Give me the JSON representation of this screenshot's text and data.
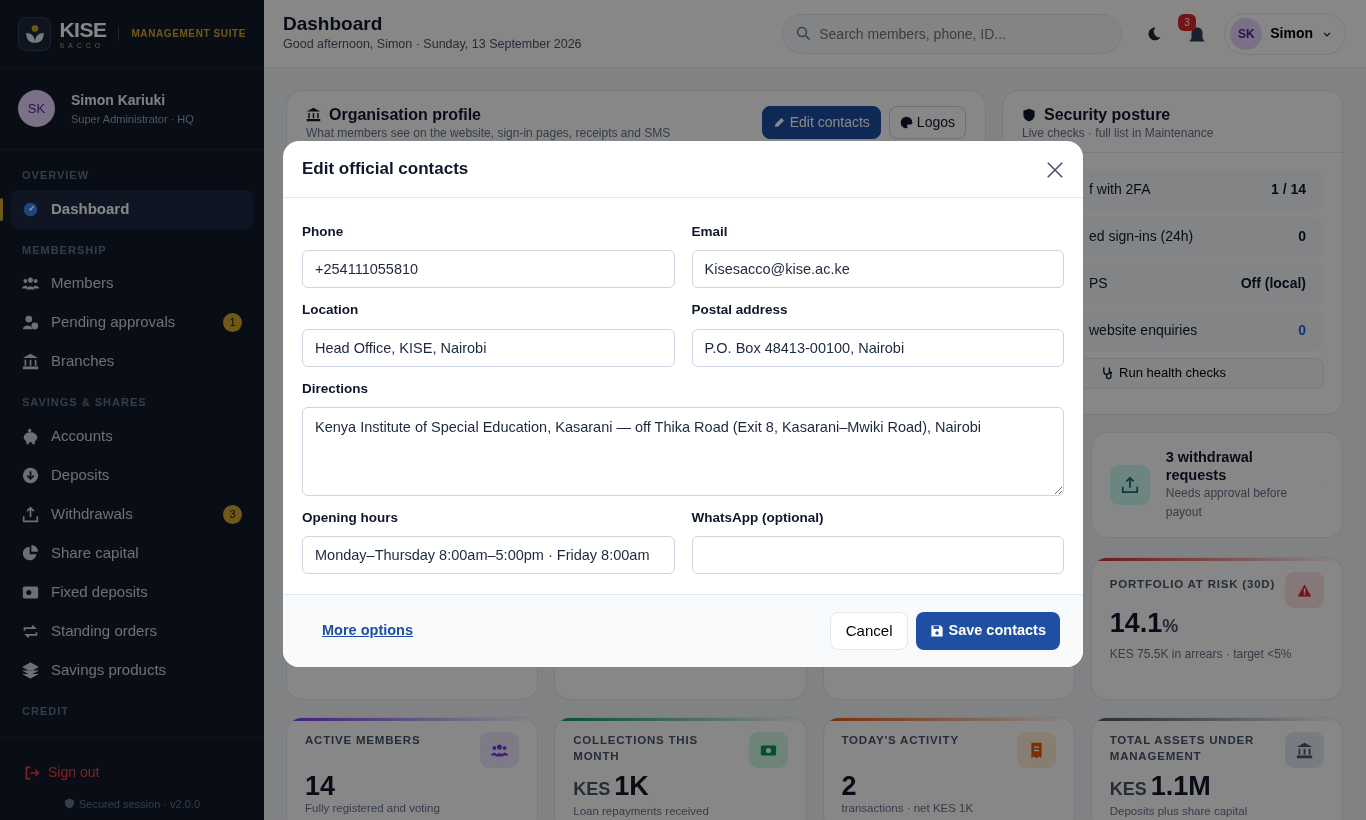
{
  "brand": {
    "name": "KISE",
    "sub": "SACCO",
    "suite": "MANAGEMENT SUITE"
  },
  "user": {
    "initials": "SK",
    "name": "Simon Kariuki",
    "role": "Super Administrator · HQ"
  },
  "nav": [
    {
      "title": "OVERVIEW",
      "items": [
        {
          "label": "Dashboard",
          "selected": true
        }
      ]
    },
    {
      "title": "MEMBERSHIP",
      "items": [
        {
          "label": "Members",
          "selected": false
        },
        {
          "label": "Pending approvals",
          "selected": false,
          "badge": "1"
        },
        {
          "label": "Branches",
          "selected": false
        }
      ]
    },
    {
      "title": "SAVINGS & SHARES",
      "items": [
        {
          "label": "Accounts",
          "selected": false
        },
        {
          "label": "Deposits",
          "selected": false
        },
        {
          "label": "Withdrawals",
          "selected": false,
          "badge": "3"
        },
        {
          "label": "Share capital",
          "selected": false
        },
        {
          "label": "Fixed deposits",
          "selected": false
        },
        {
          "label": "Standing orders",
          "selected": false
        },
        {
          "label": "Savings products",
          "selected": false
        }
      ]
    },
    {
      "title": "CREDIT"
    }
  ],
  "sign_out": "Sign out",
  "session": "Secured session · v2.0.0",
  "header": {
    "title": "Dashboard",
    "subtitle": "Good afternoon, Simon · Sunday, 13 September 2026",
    "search": {
      "placeholder": "Search members, phone, ID..."
    },
    "notifications": "3",
    "initials": "SK",
    "name": "Simon"
  },
  "org_card": {
    "title": "Organisation profile",
    "subtitle": "What members see on the website, sign-in pages, receipts and SMS",
    "buttons": [
      {
        "label": "Edit contacts",
        "kind": "primary"
      },
      {
        "label": "Logos",
        "kind": "outline"
      }
    ]
  },
  "security": {
    "title": "Security posture",
    "subtitle": "Live checks · full list in Maintenance",
    "rows": [
      {
        "label": "f with 2FA",
        "value": "1 / 14",
        "accent": false
      },
      {
        "label": "ed sign-ins (24h)",
        "value": "0",
        "accent": false
      },
      {
        "label": "PS",
        "value": "Off (local)",
        "accent": false
      },
      {
        "label": "website enquiries",
        "value": "0",
        "accent": true
      }
    ],
    "button": "Run health checks"
  },
  "alert": {
    "title": "3 withdrawal requests",
    "text": "Needs approval before payout"
  },
  "risk": {
    "label": "PORTFOLIO AT RISK (30D)",
    "value": "14.1",
    "unit": "%",
    "note": "KES 75.5K in arrears · target <5%"
  },
  "stats": [
    {
      "label": "ACTIVE MEMBERS",
      "value": "14",
      "note": "Fully registered and voting"
    },
    {
      "label": "COLLECTIONS THIS MONTH",
      "prefix": "KES",
      "value": "1K",
      "note": "Loan repayments received"
    },
    {
      "label": "TODAY'S ACTIVITY",
      "value": "2",
      "note": "transactions · net KES 1K"
    },
    {
      "label": "TOTAL ASSETS UNDER MANAGEMENT",
      "prefix": "KES",
      "value": "1.1M",
      "note": "Deposits plus share capital"
    }
  ],
  "modal": {
    "title": "Edit official contacts",
    "fields": [
      {
        "label": "Phone",
        "value": "+254111055810",
        "kind": "input"
      },
      {
        "label": "Email",
        "value": "Kisesacco@kise.ac.ke",
        "kind": "input"
      },
      {
        "label": "Location",
        "value": "Head Office, KISE, Nairobi",
        "kind": "input"
      },
      {
        "label": "Postal address",
        "value": "P.O. Box 48413-00100, Nairobi",
        "kind": "input"
      },
      {
        "label": "Directions",
        "value": "Kenya Institute of Special Education, Kasarani — off Thika Road (Exit 8, Kasarani–Mwiki Road), Nairobi",
        "kind": "textarea"
      },
      {
        "label": "Opening hours",
        "value": "Monday–Thursday 8:00am–5:00pm · Friday 8:00am",
        "kind": "input"
      },
      {
        "label": "WhatsApp (optional)",
        "kind": "input"
      }
    ],
    "link": "More options",
    "cancel": "Cancel",
    "save": "Save contacts"
  }
}
